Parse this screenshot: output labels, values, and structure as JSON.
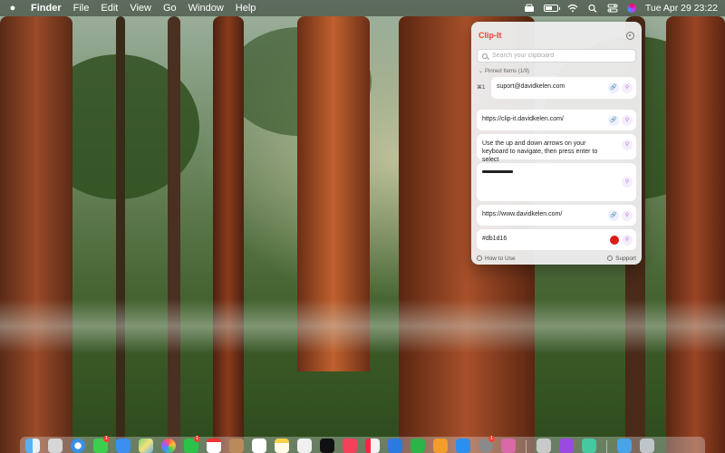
{
  "menubar": {
    "items": [
      "Finder",
      "File",
      "Edit",
      "View",
      "Go",
      "Window",
      "Help"
    ],
    "clock": "Tue Apr 29  23:22",
    "battery_level_percent": 60
  },
  "panel": {
    "title": "Clip-It",
    "search_placeholder": "Search your clipboard",
    "pinned_label": "Pinned Items (1/9)",
    "pinned": [
      {
        "shortcut": "⌘1",
        "text": "suport@davidkelen.com"
      }
    ],
    "items": [
      {
        "text": "https://clip-it.davidkelen.com/",
        "kind": "link"
      },
      {
        "text": "Use the up and down arrows on your keyboard to navigate, then press enter to select",
        "kind": "text"
      },
      {
        "text": "",
        "kind": "image"
      },
      {
        "text": "https://www.davidkelen.com/",
        "kind": "link"
      },
      {
        "text": "#db1d16",
        "kind": "color",
        "color": "#db1d16"
      }
    ],
    "footer": {
      "how_to": "How to Use",
      "support": "Support"
    }
  },
  "dock": {
    "badges": [
      "1",
      "1",
      "1"
    ]
  },
  "colors": {
    "accent": "#e0473a",
    "swatch": "#db1d16"
  }
}
